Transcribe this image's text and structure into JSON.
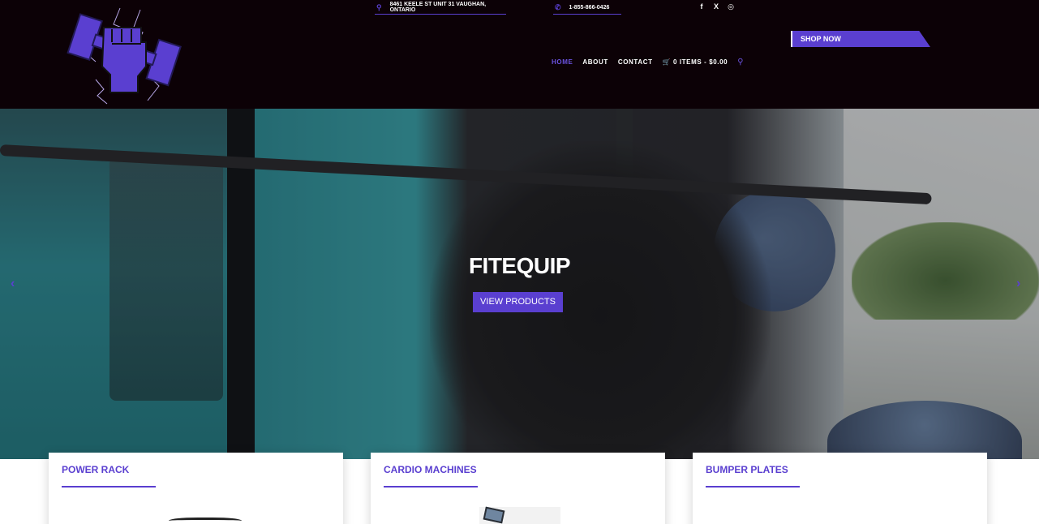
{
  "header": {
    "address": "8461 KEELE ST UNIT 31 VAUGHAN, ONTARIO",
    "phone": "1-855-866-0426",
    "shop_now": "SHOP NOW",
    "social": [
      "f",
      "X",
      "◎"
    ],
    "nav": [
      {
        "label": "HOME",
        "active": true
      },
      {
        "label": "ABOUT"
      },
      {
        "label": "CONTACT"
      },
      {
        "label": "0 ITEMS - $0.00"
      }
    ]
  },
  "hero": {
    "title": "FITEQUIP",
    "button": "VIEW PRODUCTS",
    "prev": "‹",
    "next": "›"
  },
  "cards": [
    {
      "title": "POWER RACK"
    },
    {
      "title": "CARDIO MACHINES"
    },
    {
      "title": "BUMPER PLATES"
    }
  ],
  "colors": {
    "accent": "#5a3fd0",
    "header_bg": "#0c0106"
  },
  "icons": {
    "address": "map-pin-icon",
    "phone": "phone-icon",
    "cart": "cart-icon",
    "search": "search-icon"
  }
}
